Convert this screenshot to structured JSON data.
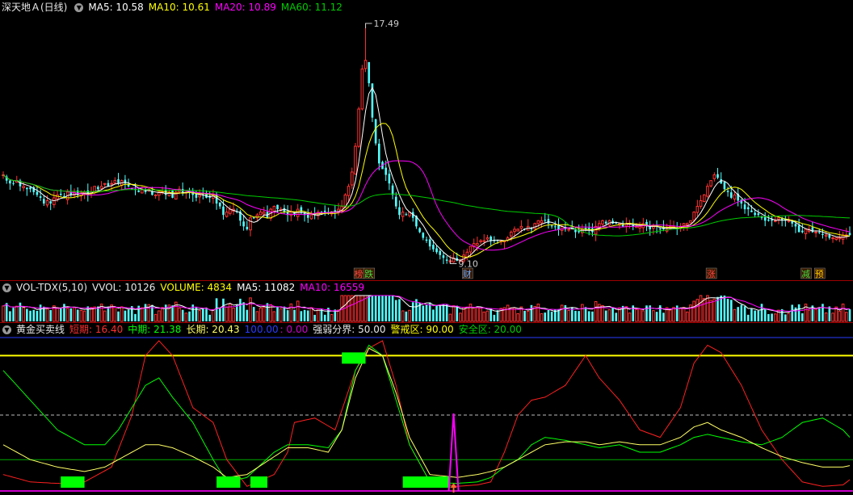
{
  "main_header": {
    "stock_name": "深天地Ａ(日线)",
    "ma5": "MA5: 10.58",
    "ma10": "MA10: 10.61",
    "ma20": "MA20: 10.89",
    "ma60": "MA60: 11.12"
  },
  "vol_header": {
    "name": "VOL-TDX(5,10)",
    "vvol": "VVOL: 10126",
    "volume": "VOLUME: 4834",
    "ma5": "MA5: 11082",
    "ma10": "MA10: 16559"
  },
  "gold_header": {
    "name": "黄金买卖线",
    "short": "短期: 16.40",
    "mid": "中期: 21.38",
    "long": "长期: 20.43",
    "v100": "100.00",
    "v0": ": 0.00",
    "strong_weak": "强弱分界: 50.00",
    "warning": "警戒区: 90.00",
    "safe": "安全区: 20.00"
  },
  "annotations": {
    "high_label": "17.49",
    "low_label": "9.10",
    "markers": [
      {
        "text": "榜",
        "x_index": 105,
        "color": "#ff4444"
      },
      {
        "text": "跌",
        "x_index": 108,
        "color": "#44dd44"
      },
      {
        "text": "财",
        "x_index": 137,
        "color": "#66aaff"
      },
      {
        "text": "涨",
        "x_index": 209,
        "color": "#ff4444"
      },
      {
        "text": "减",
        "x_index": 237,
        "color": "#44dd44"
      },
      {
        "text": "预",
        "x_index": 241,
        "color": "#ffcc00"
      }
    ]
  },
  "colors": {
    "up": "#ff3232",
    "down": "#54ffff",
    "ma5": "#ffffff",
    "ma10": "#ffff00",
    "ma20": "#ff00ff",
    "ma60": "#00cc00",
    "short": "#ff2020",
    "mid": "#00ff00",
    "long": "#ffff66",
    "signal": "#00ff00",
    "warning_line": "#ffff00"
  },
  "chart_data": [
    {
      "type": "candlestick",
      "title": "深天地Ａ(日线)",
      "ylim": [
        9.0,
        17.8
      ],
      "series": [
        {
          "name": "MA5"
        },
        {
          "name": "MA10"
        },
        {
          "name": "MA20"
        },
        {
          "name": "MA60"
        }
      ],
      "closes": [
        12.2,
        12.0,
        11.9,
        11.9,
        12.0,
        11.8,
        11.8,
        11.7,
        11.7,
        11.6,
        11.5,
        11.4,
        11.2,
        11.3,
        11.2,
        11.4,
        11.5,
        11.5,
        11.4,
        11.6,
        11.5,
        11.6,
        11.5,
        11.6,
        11.6,
        11.5,
        11.6,
        11.8,
        11.7,
        11.8,
        11.9,
        11.8,
        11.9,
        12.0,
        11.9,
        12.0,
        11.9,
        11.8,
        11.7,
        11.7,
        11.6,
        11.7,
        11.6,
        11.7,
        11.5,
        11.5,
        11.6,
        11.6,
        11.5,
        11.6,
        11.4,
        11.6,
        11.7,
        11.6,
        11.6,
        11.6,
        11.5,
        11.4,
        11.5,
        11.5,
        11.4,
        11.4,
        11.5,
        11.2,
        11.1,
        10.8,
        10.9,
        11.0,
        11.0,
        10.9,
        10.6,
        10.4,
        10.3,
        10.7,
        10.7,
        10.8,
        10.9,
        10.9,
        10.7,
        11.0,
        11.1,
        11.0,
        11.0,
        10.9,
        10.8,
        10.9,
        10.8,
        11.0,
        10.9,
        10.8,
        10.7,
        10.8,
        10.8,
        10.9,
        10.9,
        10.9,
        10.9,
        10.9,
        10.9,
        11.0,
        11.1,
        11.5,
        11.8,
        12.3,
        13.2,
        14.5,
        15.9,
        16.2,
        15.4,
        14.2,
        13.3,
        12.6,
        12.4,
        12.2,
        11.9,
        11.5,
        11.1,
        10.8,
        10.9,
        10.8,
        10.9,
        10.7,
        10.4,
        10.2,
        10.0,
        9.9,
        9.7,
        9.6,
        9.5,
        9.4,
        9.3,
        9.2,
        9.2,
        9.3,
        9.2,
        9.2,
        9.4,
        9.5,
        9.7,
        9.8,
        9.8,
        9.9,
        9.9,
        10.0,
        9.9,
        9.9,
        9.9,
        9.9,
        9.9,
        10.0,
        10.2,
        10.3,
        10.3,
        10.4,
        10.3,
        10.4,
        10.3,
        10.5,
        10.6,
        10.6,
        10.6,
        10.5,
        10.4,
        10.4,
        10.3,
        10.4,
        10.3,
        10.3,
        10.3,
        10.2,
        10.2,
        10.3,
        10.3,
        10.3,
        10.2,
        10.4,
        10.5,
        10.6,
        10.5,
        10.6,
        10.5,
        10.5,
        10.5,
        10.4,
        10.5,
        10.5,
        10.4,
        10.4,
        10.4,
        10.5,
        10.4,
        10.3,
        10.4,
        10.4,
        10.3,
        10.3,
        10.3,
        10.4,
        10.4,
        10.3,
        10.4,
        10.5,
        10.5,
        10.6,
        10.9,
        11.1,
        11.3,
        11.5,
        11.8,
        12.0,
        12.2,
        12.1,
        11.9,
        11.7,
        11.6,
        11.4,
        11.5,
        11.3,
        11.2,
        11.0,
        11.0,
        10.9,
        10.8,
        10.8,
        10.7,
        10.6,
        10.6,
        10.6,
        10.6,
        10.7,
        10.6,
        10.6,
        10.6,
        10.5,
        10.4,
        10.2,
        10.2,
        10.3,
        10.3,
        10.2,
        10.2,
        10.2,
        10.1,
        10.1,
        10.0,
        10.0,
        10.0,
        10.0,
        10.1,
        10.1,
        10.1
      ]
    },
    {
      "type": "bar",
      "title": "VOL-TDX(5,10)",
      "series": [
        {
          "name": "MA5"
        },
        {
          "name": "MA10"
        }
      ],
      "ylim": [
        0,
        100
      ]
    },
    {
      "type": "line",
      "title": "黄金买卖线",
      "ylim": [
        0,
        100
      ],
      "series": [
        {
          "name": "短期",
          "keypoints": [
            [
              0,
              10
            ],
            [
              8,
              5
            ],
            [
              16,
              4
            ],
            [
              24,
              5
            ],
            [
              32,
              15
            ],
            [
              38,
              50
            ],
            [
              42,
              90
            ],
            [
              46,
              100
            ],
            [
              50,
              90
            ],
            [
              56,
              55
            ],
            [
              62,
              45
            ],
            [
              66,
              20
            ],
            [
              72,
              2
            ],
            [
              80,
              10
            ],
            [
              84,
              25
            ],
            [
              86,
              45
            ],
            [
              92,
              48
            ],
            [
              98,
              40
            ],
            [
              104,
              80
            ],
            [
              108,
              95
            ],
            [
              112,
              100
            ],
            [
              116,
              70
            ],
            [
              120,
              30
            ],
            [
              126,
              5
            ],
            [
              134,
              2
            ],
            [
              140,
              3
            ],
            [
              144,
              5
            ],
            [
              148,
              25
            ],
            [
              152,
              50
            ],
            [
              156,
              60
            ],
            [
              160,
              62
            ],
            [
              166,
              70
            ],
            [
              172,
              90
            ],
            [
              176,
              75
            ],
            [
              182,
              60
            ],
            [
              188,
              40
            ],
            [
              194,
              35
            ],
            [
              200,
              55
            ],
            [
              204,
              85
            ],
            [
              208,
              97
            ],
            [
              212,
              92
            ],
            [
              218,
              70
            ],
            [
              224,
              40
            ],
            [
              230,
              20
            ],
            [
              236,
              5
            ],
            [
              242,
              2
            ],
            [
              248,
              3
            ],
            [
              252,
              10
            ],
            [
              256,
              15
            ],
            [
              260,
              20
            ]
          ]
        },
        {
          "name": "中期",
          "keypoints": [
            [
              0,
              80
            ],
            [
              8,
              60
            ],
            [
              16,
              40
            ],
            [
              24,
              30
            ],
            [
              30,
              30
            ],
            [
              34,
              40
            ],
            [
              38,
              55
            ],
            [
              42,
              70
            ],
            [
              46,
              75
            ],
            [
              50,
              62
            ],
            [
              56,
              45
            ],
            [
              62,
              20
            ],
            [
              66,
              5
            ],
            [
              72,
              8
            ],
            [
              80,
              25
            ],
            [
              84,
              30
            ],
            [
              90,
              30
            ],
            [
              96,
              28
            ],
            [
              100,
              40
            ],
            [
              104,
              80
            ],
            [
              108,
              97
            ],
            [
              112,
              90
            ],
            [
              116,
              60
            ],
            [
              120,
              30
            ],
            [
              126,
              5
            ],
            [
              134,
              4
            ],
            [
              140,
              5
            ],
            [
              144,
              8
            ],
            [
              148,
              15
            ],
            [
              152,
              20
            ],
            [
              156,
              30
            ],
            [
              160,
              35
            ],
            [
              166,
              33
            ],
            [
              172,
              30
            ],
            [
              176,
              28
            ],
            [
              182,
              30
            ],
            [
              188,
              25
            ],
            [
              194,
              25
            ],
            [
              200,
              30
            ],
            [
              204,
              35
            ],
            [
              208,
              37
            ],
            [
              212,
              35
            ],
            [
              218,
              32
            ],
            [
              224,
              30
            ],
            [
              230,
              35
            ],
            [
              236,
              45
            ],
            [
              242,
              48
            ],
            [
              248,
              40
            ],
            [
              252,
              30
            ],
            [
              256,
              25
            ],
            [
              260,
              25
            ]
          ]
        },
        {
          "name": "长期",
          "keypoints": [
            [
              0,
              30
            ],
            [
              8,
              20
            ],
            [
              16,
              15
            ],
            [
              24,
              12
            ],
            [
              30,
              15
            ],
            [
              34,
              20
            ],
            [
              38,
              25
            ],
            [
              42,
              30
            ],
            [
              46,
              30
            ],
            [
              50,
              28
            ],
            [
              56,
              22
            ],
            [
              62,
              15
            ],
            [
              66,
              8
            ],
            [
              72,
              10
            ],
            [
              80,
              22
            ],
            [
              84,
              28
            ],
            [
              90,
              28
            ],
            [
              96,
              25
            ],
            [
              100,
              40
            ],
            [
              104,
              75
            ],
            [
              108,
              95
            ],
            [
              112,
              90
            ],
            [
              116,
              65
            ],
            [
              120,
              35
            ],
            [
              126,
              10
            ],
            [
              134,
              8
            ],
            [
              140,
              10
            ],
            [
              144,
              12
            ],
            [
              148,
              15
            ],
            [
              152,
              20
            ],
            [
              156,
              25
            ],
            [
              160,
              30
            ],
            [
              166,
              32
            ],
            [
              172,
              32
            ],
            [
              176,
              30
            ],
            [
              182,
              32
            ],
            [
              188,
              30
            ],
            [
              194,
              30
            ],
            [
              200,
              35
            ],
            [
              204,
              42
            ],
            [
              208,
              45
            ],
            [
              212,
              40
            ],
            [
              218,
              35
            ],
            [
              224,
              28
            ],
            [
              230,
              22
            ],
            [
              236,
              18
            ],
            [
              242,
              15
            ],
            [
              248,
              15
            ],
            [
              252,
              17
            ],
            [
              256,
              20
            ],
            [
              260,
              20
            ]
          ]
        }
      ],
      "signals": [
        {
          "from": 17,
          "to": 24,
          "level": 0
        },
        {
          "from": 63,
          "to": 70,
          "level": 0
        },
        {
          "from": 73,
          "to": 78,
          "level": 0
        },
        {
          "from": 100,
          "to": 107,
          "level": 90
        },
        {
          "from": 118,
          "to": 132,
          "level": 0
        }
      ],
      "spike_index": 133,
      "reference_lines": {
        "strong_weak": 50,
        "warning": 90,
        "safe": 20
      }
    }
  ]
}
